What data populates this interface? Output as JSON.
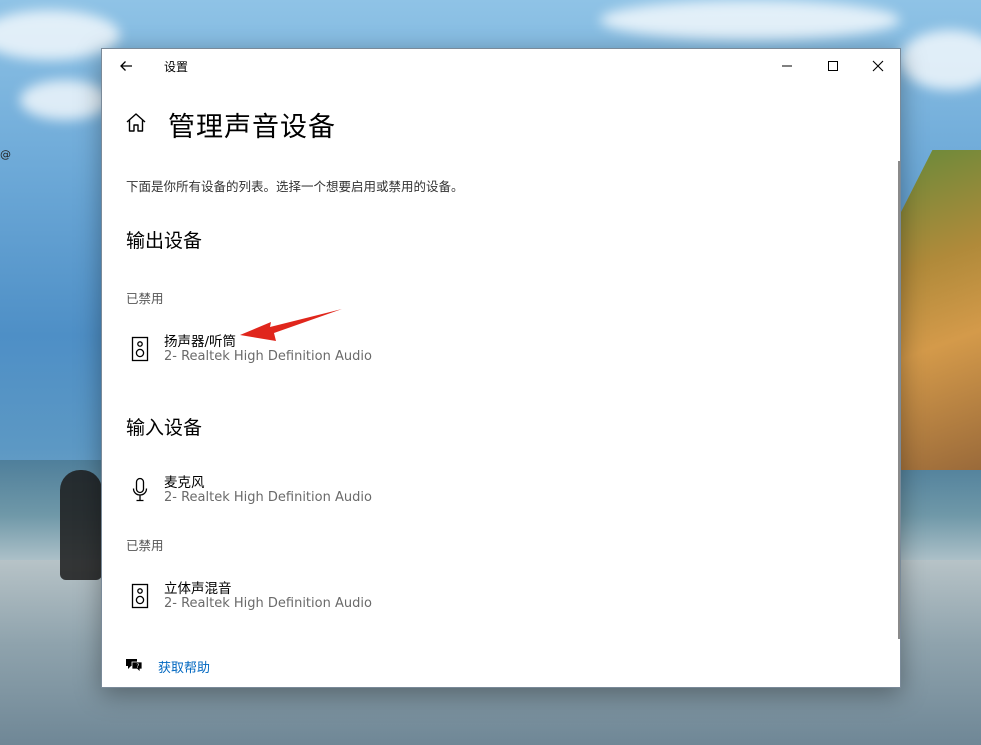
{
  "window": {
    "title": "设置"
  },
  "page": {
    "title": "管理声音设备",
    "description": "下面是你所有设备的列表。选择一个想要启用或禁用的设备。"
  },
  "output": {
    "heading": "输出设备",
    "disabled_label": "已禁用",
    "devices": [
      {
        "name": "扬声器/听筒",
        "driver": "2- Realtek High Definition Audio",
        "icon": "speaker-icon"
      }
    ]
  },
  "input": {
    "heading": "输入设备",
    "devices": [
      {
        "name": "麦克风",
        "driver": "2- Realtek High Definition Audio",
        "icon": "microphone-icon"
      }
    ],
    "disabled_label": "已禁用",
    "disabled_devices": [
      {
        "name": "立体声混音",
        "driver": "2- Realtek High Definition Audio",
        "icon": "speaker-icon"
      }
    ]
  },
  "help": {
    "label": "获取帮助",
    "icon": "chat-help-icon"
  },
  "desktop": {
    "stray_glyph": "@"
  },
  "colors": {
    "accent_link": "#0067c0",
    "annotation_arrow": "#e0261c"
  }
}
